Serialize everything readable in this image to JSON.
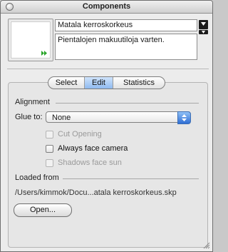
{
  "window": {
    "title": "Components"
  },
  "component": {
    "name": "Matala kerroskorkeus",
    "description": "Pientalojen makuutiloja varten."
  },
  "tabs": [
    {
      "label": "Select",
      "active": false
    },
    {
      "label": "Edit",
      "active": true
    },
    {
      "label": "Statistics",
      "active": false
    }
  ],
  "alignment": {
    "section_label": "Alignment",
    "glue_label": "Glue to:",
    "glue_value": "None",
    "options": [
      {
        "label": "Cut Opening",
        "checked": false,
        "enabled": false
      },
      {
        "label": "Always face camera",
        "checked": false,
        "enabled": true
      },
      {
        "label": "Shadows face sun",
        "checked": false,
        "enabled": false
      }
    ]
  },
  "loaded_from": {
    "section_label": "Loaded from",
    "path": "/Users/kimmok/Docu...atala kerroskorkeus.skp",
    "open_button": "Open..."
  },
  "colors": {
    "active_tab": "#8fbaf0",
    "select_arrows": "#2f6ed4"
  },
  "icons": {
    "close": "close-icon",
    "preview_arrows": "double-arrow-right-icon",
    "details_button": "arrow-down-flyout-icon",
    "select_arrows": "up-down-chevron-icon",
    "resize": "resize-grip-icon"
  }
}
